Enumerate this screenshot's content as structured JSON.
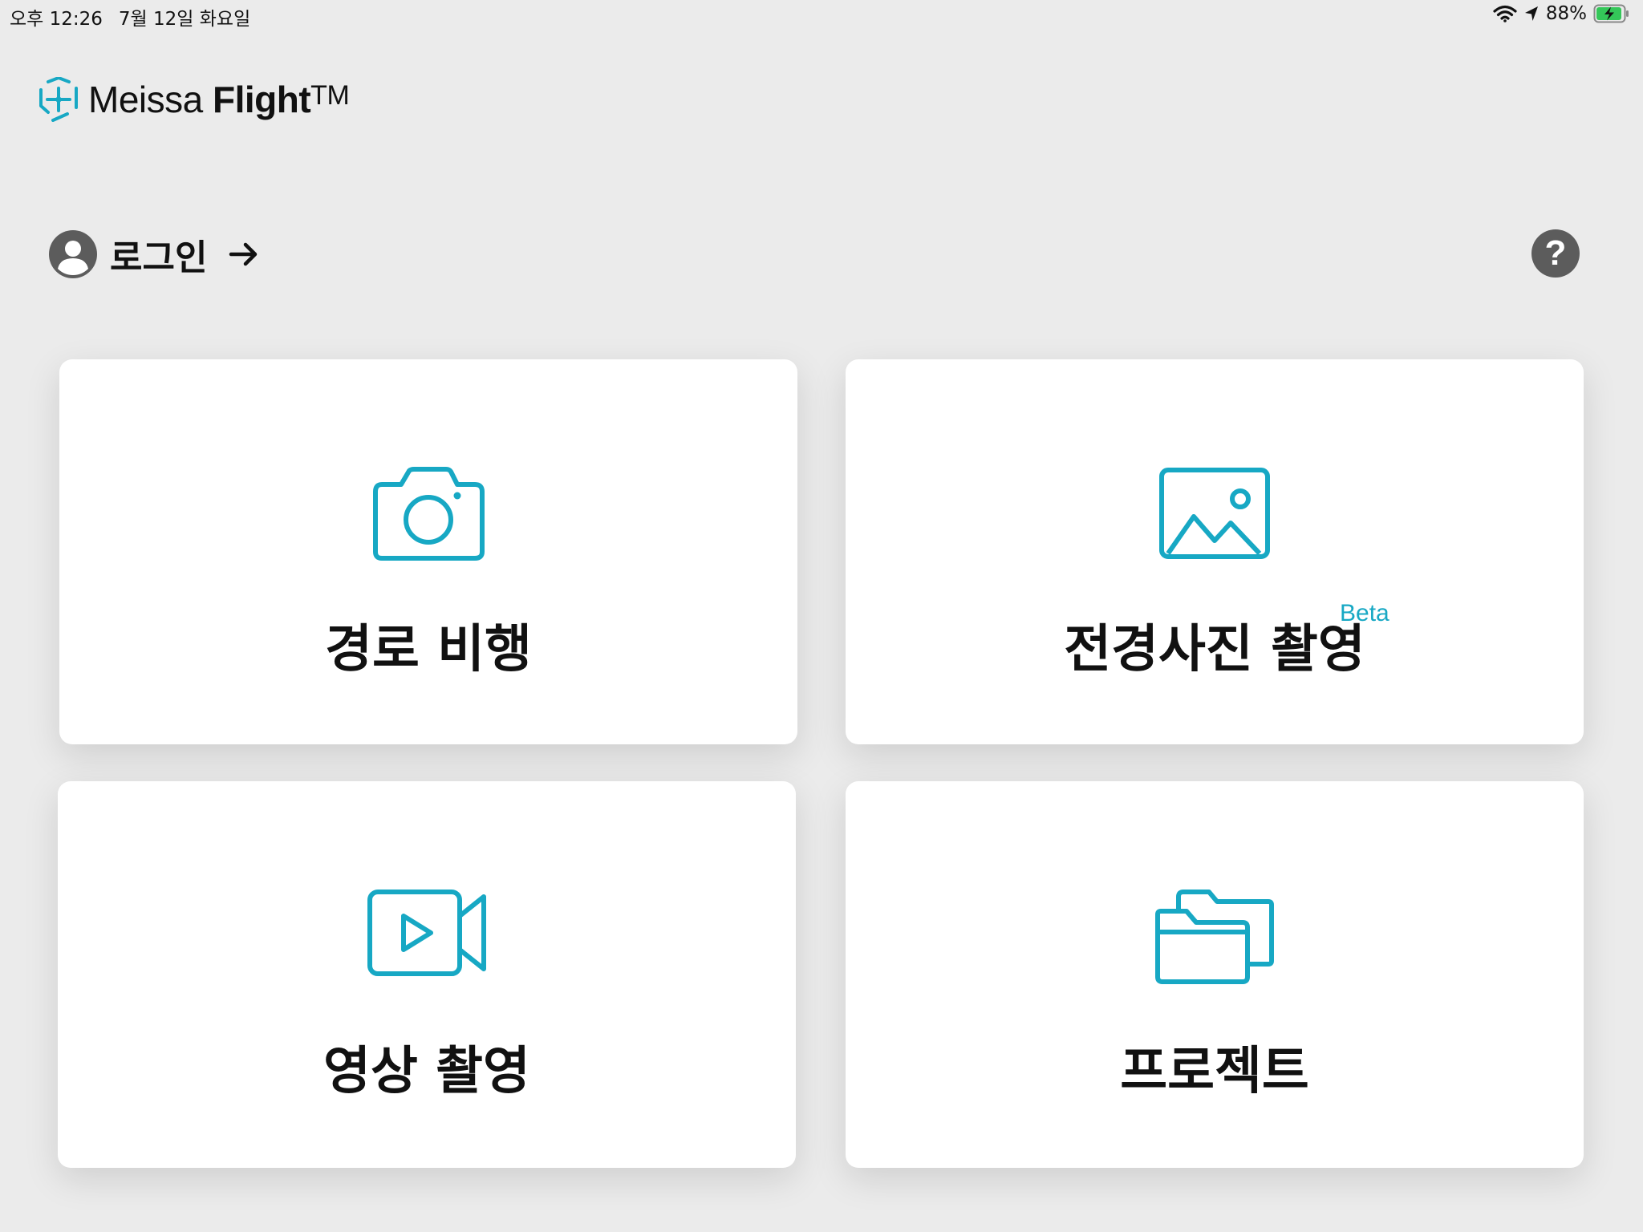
{
  "status_bar": {
    "time": "오후 12:26",
    "date": "7월 12일 화요일",
    "battery": "88%"
  },
  "brand": {
    "name_regular": "Meissa ",
    "name_bold": "Flight",
    "trademark": "TM"
  },
  "login": {
    "label": "로그인"
  },
  "help": {
    "symbol": "?"
  },
  "colors": {
    "accent": "#17a8c4",
    "background": "#ebebeb",
    "card": "#ffffff",
    "help_button": "#5c5c5c"
  },
  "cards": [
    {
      "label": "경로 비행",
      "icon": "camera-icon"
    },
    {
      "label": "전경사진 촬영",
      "icon": "image-icon",
      "badge": "Beta"
    },
    {
      "label": "영상 촬영",
      "icon": "video-camera-icon"
    },
    {
      "label": "프로젝트",
      "icon": "folders-icon"
    }
  ]
}
